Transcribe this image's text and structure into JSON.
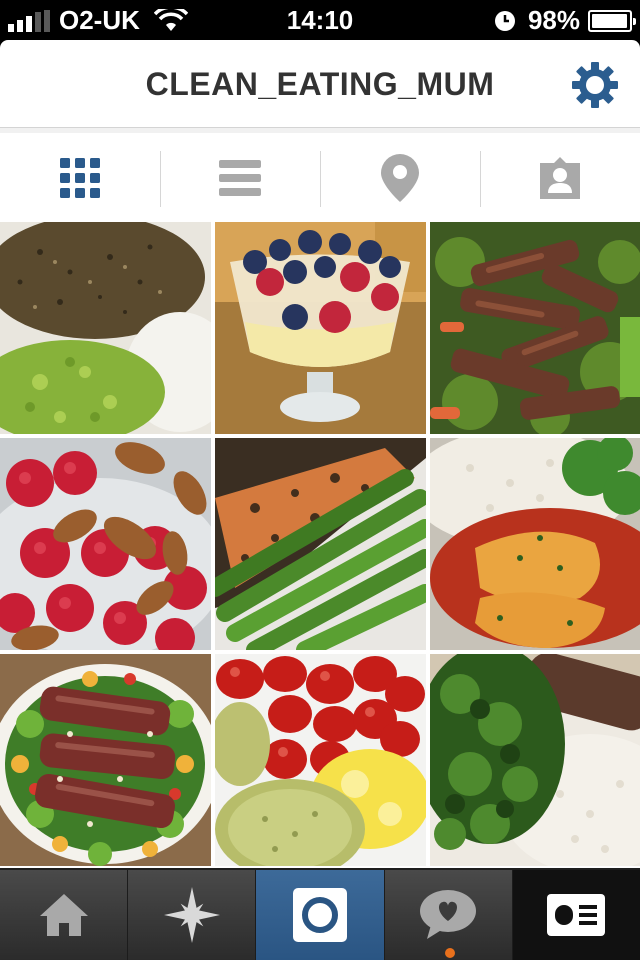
{
  "status_bar": {
    "carrier": "O2-UK",
    "time": "14:10",
    "battery": "98%",
    "battery_level": 0.98
  },
  "header": {
    "title": "CLEAN_EATING_MUM",
    "settings_icon": "gear-icon"
  },
  "view_tabs": [
    {
      "name": "grid-view",
      "icon": "grid-icon",
      "active": true
    },
    {
      "name": "list-view",
      "icon": "list-icon",
      "active": false
    },
    {
      "name": "photo-map",
      "icon": "map-pin-icon",
      "active": false
    },
    {
      "name": "photos-of-you",
      "icon": "tagged-person-icon",
      "active": false
    }
  ],
  "photos": [
    {
      "subject": "seeded-chicken-guacamole"
    },
    {
      "subject": "berry-yogurt-parfait"
    },
    {
      "subject": "beef-stir-fry"
    },
    {
      "subject": "raspberries-almonds"
    },
    {
      "subject": "salmon-asparagus"
    },
    {
      "subject": "rice-fish-tomato-sauce"
    },
    {
      "subject": "duck-salad"
    },
    {
      "subject": "tomatoes-eggs-potato"
    },
    {
      "subject": "steak-kale-rice"
    }
  ],
  "tab_bar": [
    {
      "name": "home",
      "icon": "home-icon",
      "active": false
    },
    {
      "name": "explore",
      "icon": "star-icon",
      "active": false
    },
    {
      "name": "camera",
      "icon": "camera-icon",
      "active": true
    },
    {
      "name": "activity",
      "icon": "heart-bubble-icon",
      "active": false
    },
    {
      "name": "profile",
      "icon": "profile-card-icon",
      "active": false
    }
  ],
  "colors": {
    "accent": "#2a5a8c",
    "inactive_icon": "#a9a9a9",
    "notification": "#e8701c"
  }
}
